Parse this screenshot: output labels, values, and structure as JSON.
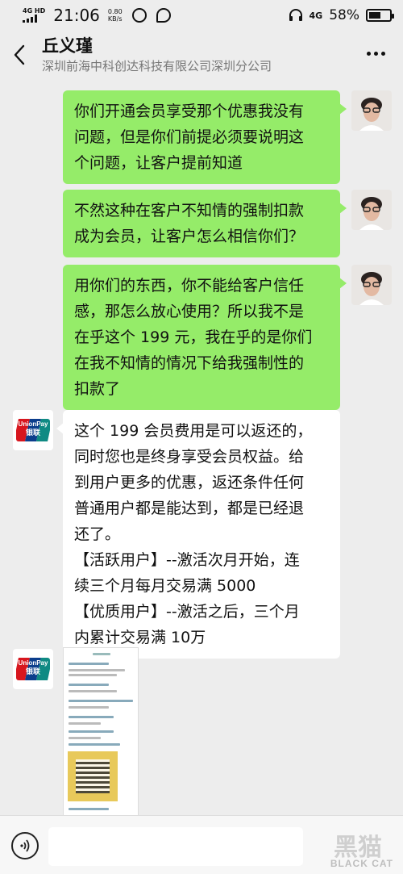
{
  "status_bar": {
    "network": "4G HD",
    "time": "21:06",
    "speed_value": "0.80",
    "speed_unit": "KB/s",
    "network2": "4G",
    "battery": "58%",
    "battery_level": 0.58
  },
  "header": {
    "title": "丘义瑾",
    "subtitle": "深圳前海中科创达科技有限公司深圳分公司"
  },
  "messages": [
    {
      "side": "out",
      "lines": [
        "你们开通会员享受那个优惠我没有",
        "问题，但是你们前提必须要说明这",
        "个问题，让客户提前知道"
      ]
    },
    {
      "side": "out",
      "lines": [
        "不然这种在客户不知情的强制扣款",
        "成为会员，让客户怎么相信你们？"
      ]
    },
    {
      "side": "out",
      "lines": [
        "用你们的东西，你不能给客户信任",
        "感，那怎么放心使用？所以我不是",
        "在乎这个 199 元，我在乎的是你们",
        "在我不知情的情况下给我强制性的",
        "扣款了"
      ]
    },
    {
      "side": "in",
      "sender_logo": "UnionPay 银联",
      "lines": [
        "这个 199 会员费用是可以返还的，",
        "同时您也是终身享受会员权益。给",
        "到用户更多的优惠，返还条件任何",
        "普通用户都是能达到，都是已经退",
        "还了。",
        "【活跃用户】--激活次月开始，连",
        "续三个月每月交易满 5000",
        "【优质用户】--激活之后，三个月",
        "内累计交易满 10万"
      ]
    },
    {
      "side": "in",
      "sender_logo": "UnionPay 银联",
      "type": "image"
    }
  ],
  "unionpay": {
    "text_en": "UnionPay",
    "text_cn": "银联",
    "colors": [
      "#d7161e",
      "#0b3d8c",
      "#0f8a83"
    ]
  },
  "input_bar": {
    "watermark_cn": "黑猫",
    "watermark_en": "BLACK CAT"
  },
  "colors": {
    "outgoing_bubble": "#95ec69",
    "incoming_bubble": "#ffffff",
    "background": "#ededed"
  }
}
